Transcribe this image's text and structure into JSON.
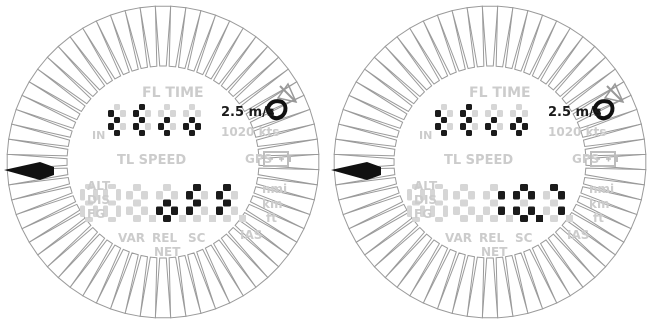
{
  "panels": [
    {
      "id": "left",
      "top_segments": "tEco",
      "main_segments": "oFF",
      "labels": {
        "fl_time": "FL TIME",
        "in": "IN",
        "speed_small": "2.5 m/s",
        "kts": "1020 kts",
        "tl_speed": "TL SPEED",
        "gps": "GPS",
        "alt": "ALT",
        "dis": "DIS",
        "fg": "FG",
        "nmi": "nmi",
        "km": "km",
        "ft": "ft",
        "var": "VAR",
        "rel": "REL",
        "sc": "SC",
        "net": "NET",
        "ias": "IAS"
      }
    },
    {
      "id": "right",
      "top_segments": "tEco",
      "main_segments": "10.7",
      "labels": {
        "fl_time": "FL TIME",
        "in": "IN",
        "speed_small": "2.5 m/s",
        "kts": "1020 kts",
        "tl_speed": "TL SPEED",
        "gps": "GPS",
        "alt": "ALT",
        "dis": "DIS",
        "fg": "FG",
        "nmi": "nmi",
        "km": "km",
        "ft": "ft",
        "var": "VAR",
        "rel": "REL",
        "sc": "SC",
        "net": "NET",
        "ias": "IAS"
      }
    }
  ],
  "colors": {
    "segment_on": "#1b1b1b",
    "segment_off": "#d6d6d6",
    "ring_stroke": "#9a9a9a",
    "needle": "#111111"
  },
  "icons": {
    "thermal": "spiral-arrow-icon",
    "battery": "battery-icon"
  }
}
